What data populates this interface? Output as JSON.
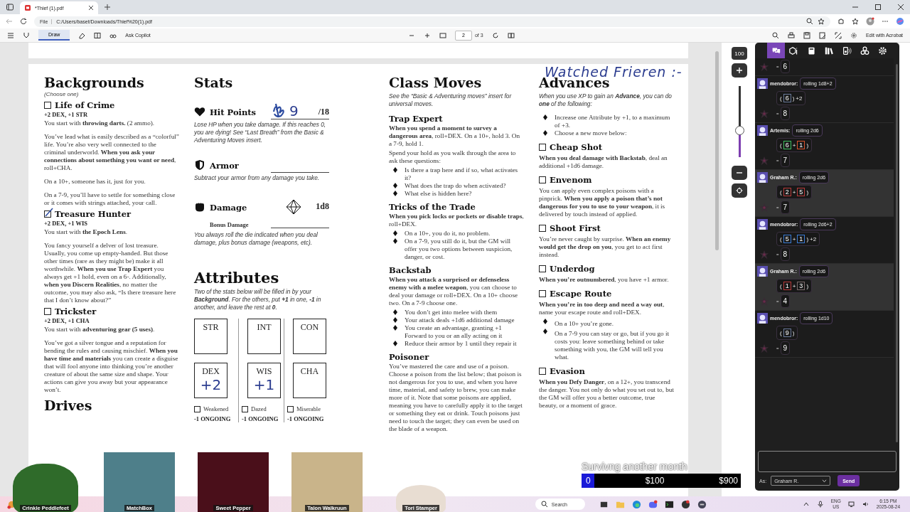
{
  "browser": {
    "tab_title": "*Thief (1).pdf",
    "address_label": "File",
    "url": "C:/Users/baset/Downloads/Thief%20(1).pdf"
  },
  "pdf_toolbar": {
    "draw": "Draw",
    "ask": "Ask Copilot",
    "page": "2",
    "page_count": "of 3",
    "edit": "Edit with Acrobat"
  },
  "annotation": "Watched Frieren :-",
  "backgrounds": {
    "title": "Backgrounds",
    "subtitle": "(Choose one)",
    "items": [
      {
        "name": "Life of Crime",
        "checked": false,
        "bonus": "+2 DEX, +1 STR",
        "paragraphs": [
          "You start with **throwing darts.** (2 ammo).",
          "You’ve lead what is easily described as a “colorful” life. You’re also very well connected to the criminal underworld. **When you ask your connections about something you want or need**, roll+CHA.",
          "On a 10+, someone has it, just for you.",
          "On a 7-9, you’ll have to settle for something close or it comes with strings attached, your call."
        ]
      },
      {
        "name": "Treasure Hunter",
        "checked": true,
        "bonus": "+2 DEX, +1 WIS",
        "paragraphs": [
          "You start with **the Epoch Lens**.",
          "You fancy yourself a delver of lost treasure. Usually, you come up empty-handed. But those other times (rare as they might be) make it all worthwhile. **When you use Trap Expert** you always get +1 hold, even on a 6-. Additionally, **when you Discern Realities**, no matter the outcome, you may also ask, “Is there treasure here that I don’t know about?”"
        ]
      },
      {
        "name": "Trickster",
        "checked": false,
        "bonus": "+2 DEX, +1 CHA",
        "paragraphs": [
          "You start with **adventuring gear (5 uses)**.",
          "You’ve got a silver tongue and a reputation for bending the rules and causing mischief. **When you have time and materials** you can create a disguise that will fool anyone into thinking you’re another creature of about the same size and shape. Your actions can give you away but your appearance won’t."
        ]
      }
    ]
  },
  "drives": "Drives",
  "stats": {
    "title": "Stats",
    "hit_points": {
      "label": "Hit Points",
      "value": "9",
      "max": "/18",
      "note": "Lose HP when you take damage. If this reaches 0, you are dying! See “Last Breath” from the Basic & Adventuring Moves insert."
    },
    "armor": {
      "label": "Armor",
      "note": "Subtract your armor from any damage you take."
    },
    "damage": {
      "label": "Damage",
      "die": "1d8",
      "bonus_label": "Bonus Damage",
      "note": "You always roll the die indicated when you deal damage, plus bonus damage (weapons, etc)."
    }
  },
  "attributes": {
    "title": "Attributes",
    "note": "Two of the stats below will be filled in by your **Background**. For the others, put **+1** in one, **-1** in another, and leave the rest at **0**.",
    "columns": [
      {
        "top": {
          "name": "STR"
        },
        "bottom": {
          "name": "DEX",
          "value": "+2"
        },
        "condition": {
          "label": "Weakened",
          "checked": false,
          "effect": "-1 ONGOING"
        }
      },
      {
        "top": {
          "name": "INT"
        },
        "bottom": {
          "name": "WIS",
          "value": "+1"
        },
        "condition": {
          "label": "Dazed",
          "checked": false,
          "effect": "-1 ONGOING"
        }
      },
      {
        "top": {
          "name": "CON"
        },
        "bottom": {
          "name": "CHA"
        },
        "condition": {
          "label": "Miserable",
          "checked": false,
          "effect": "-1 ONGOING"
        }
      }
    ]
  },
  "class_moves": {
    "title": "Class Moves",
    "note": "See the “Basic & Adventuring moves” insert for universal moves.",
    "moves": [
      {
        "name": "Trap Expert",
        "paragraphs": [
          "**When you spend a moment to survey a dangerous area**, roll+DEX. On a 10+, hold 3. On a 7-9, hold 1.",
          "Spend your hold as you walk through the area to ask these questions:"
        ],
        "bullets": [
          "Is there a trap here and if so, what activates it?",
          "What does the trap do when activated?",
          "What else is hidden here?"
        ]
      },
      {
        "name": "Tricks of the Trade",
        "paragraphs": [
          "**When you pick locks or pockets or disable traps**, roll+DEX."
        ],
        "bullets": [
          "On a 10+, you do it, no problem.",
          "On a 7-9, you still do it, but the GM will offer you two options between suspicion, danger, or cost."
        ]
      },
      {
        "name": "Backstab",
        "paragraphs": [
          "**When you attack a surprised or defenseless enemy with a melee weapon**, you can choose to deal your damage or roll+DEX. On a 10+ choose two. On a 7-9 choose one."
        ],
        "bullets": [
          "You don’t get into melee with them",
          "Your attack deals +1d6 additional damage",
          "You create an advantage, granting +1 Forward to you or an ally acting on it",
          "Reduce their armor by 1 until they repair it"
        ]
      },
      {
        "name": "Poisoner",
        "paragraphs": [
          "You’ve mastered the care and use of a poison. Choose a poison from the list below; that poison is not dangerous for you to use, and when you have time, material, and safety to brew, you can make more of it. Note that some poisons are applied, meaning you have to carefully apply it to the target or something they eat or drink. Touch poisons just need to touch the target; they can even be used on the blade of a weapon."
        ]
      }
    ]
  },
  "advances": {
    "title": "Advances",
    "note": "When you use XP to gain an **Advance**, you can do **one** of the following:",
    "bullets": [
      "Increase one Attribute by +1, to a maximum of +3.",
      "Choose a new move below:"
    ],
    "options": [
      {
        "name": "Cheap Shot",
        "checked": false,
        "text": "**When you deal damage with Backstab**, deal an additional +1d6 damage."
      },
      {
        "name": "Envenom",
        "checked": false,
        "text": "You can apply even complex poisons with a pinprick. **When you apply a poison that’s not dangerous for you to use to your weapon**, it is delivered by touch instead of applied."
      },
      {
        "name": "Shoot First",
        "checked": false,
        "text": "You’re never caught by surprise. **When an enemy would get the drop on you**, you get to act first instead."
      },
      {
        "name": "Underdog",
        "checked": false,
        "text": "**When you’re outnumbered**, you have +1 armor."
      },
      {
        "name": "Escape Route",
        "checked": false,
        "text": "**When you’re in too deep and need a way out**, name your escape route and roll+DEX.",
        "bullets": [
          "On a 10+ you’re gone.",
          "On a 7-9 you can stay or go, but if you go it costs you: leave something behind or take something with you, the GM will tell you what."
        ]
      },
      {
        "name": "Evasion",
        "checked": false,
        "text": "**When you Defy Danger**, on a 12+, you transcend the danger. You not only do what you set out to, but the GM will offer you a better outcome, true beauty, or a moment of grace."
      }
    ]
  },
  "zoom": {
    "value": "100",
    "level": 0.38
  },
  "chat": {
    "tabs": [
      {
        "kind": "chat",
        "selected": true
      },
      {
        "kind": "dice",
        "selected": false
      },
      {
        "kind": "book",
        "selected": false
      },
      {
        "kind": "library",
        "selected": false
      },
      {
        "kind": "speaker",
        "selected": false
      },
      {
        "kind": "tokens",
        "selected": false
      },
      {
        "kind": "settings",
        "selected": false
      }
    ],
    "messages": [
      {
        "own": false,
        "equals": "=",
        "result": "6"
      },
      {
        "name": "mendobror:",
        "roll": "rolling 1d8+2",
        "own": false,
        "parts": [
          {
            "kind": "paren",
            "text": "("
          },
          {
            "kind": "die",
            "text": "6",
            "color": "#6a7a9a"
          },
          {
            "kind": "paren",
            "text": ")"
          },
          {
            "kind": "mod",
            "text": "+2"
          }
        ],
        "equals": "=",
        "result": "8"
      },
      {
        "name": "Artemis:",
        "roll": "rolling 2d6",
        "own": false,
        "parts": [
          {
            "kind": "paren",
            "text": "("
          },
          {
            "kind": "die",
            "text": "6",
            "color": "#3fbf5f"
          },
          {
            "kind": "op",
            "text": "+"
          },
          {
            "kind": "die",
            "text": "1",
            "color": "#d9532b"
          },
          {
            "kind": "paren",
            "text": ")"
          }
        ],
        "equals": "=",
        "result": "7"
      },
      {
        "name": "Graham R.:",
        "roll": "rolling 2d6",
        "own": true,
        "parts": [
          {
            "kind": "paren",
            "text": "("
          },
          {
            "kind": "die",
            "text": "2",
            "color": "#b83a3a"
          },
          {
            "kind": "op",
            "text": "+"
          },
          {
            "kind": "die",
            "text": "5",
            "color": "#b83a3a"
          },
          {
            "kind": "paren",
            "text": ")"
          }
        ],
        "equals": "=",
        "result": "7"
      },
      {
        "name": "mendobror:",
        "roll": "rolling 2d6+2",
        "own": false,
        "parts": [
          {
            "kind": "paren",
            "text": "("
          },
          {
            "kind": "die",
            "text": "5",
            "color": "#3a7bd5"
          },
          {
            "kind": "op",
            "text": "+"
          },
          {
            "kind": "die",
            "text": "1",
            "color": "#3a7bd5"
          },
          {
            "kind": "paren",
            "text": ")"
          },
          {
            "kind": "mod",
            "text": "+2"
          }
        ],
        "equals": "=",
        "result": "8"
      },
      {
        "name": "Graham R.:",
        "roll": "rolling 2d6",
        "own": true,
        "parts": [
          {
            "kind": "paren",
            "text": "("
          },
          {
            "kind": "die",
            "text": "1",
            "color": "#b83a3a"
          },
          {
            "kind": "op",
            "text": "+"
          },
          {
            "kind": "die",
            "text": "3",
            "color": "#7a6a6a"
          },
          {
            "kind": "paren",
            "text": ")"
          }
        ],
        "equals": "=",
        "result": "4"
      },
      {
        "name": "mendobror:",
        "roll": "rolling 1d10",
        "own": false,
        "parts": [
          {
            "kind": "paren",
            "text": "("
          },
          {
            "kind": "die",
            "text": "9",
            "color": "#6a7a9a"
          },
          {
            "kind": "paren",
            "text": ")"
          }
        ],
        "equals": "=",
        "result": "9"
      }
    ],
    "as_label": "As:",
    "speaker": "Graham R.",
    "send": "Send"
  },
  "stream": {
    "viewers": [
      {
        "name": "Crinkle Peddlefeet"
      },
      {
        "name": "MatchBox"
      },
      {
        "name": "Sweet Pepper"
      },
      {
        "name": "Talon Walkruun"
      },
      {
        "name": "Tori Stamper"
      }
    ],
    "goal": {
      "title": "Survivng another month",
      "level": 0.08,
      "labels": [
        "0",
        "$100",
        "$900"
      ]
    }
  },
  "taskbar": {
    "search": "Search",
    "lang": "ENG",
    "region": "US",
    "time": "6:15 PM",
    "date": "2025-08-24"
  }
}
